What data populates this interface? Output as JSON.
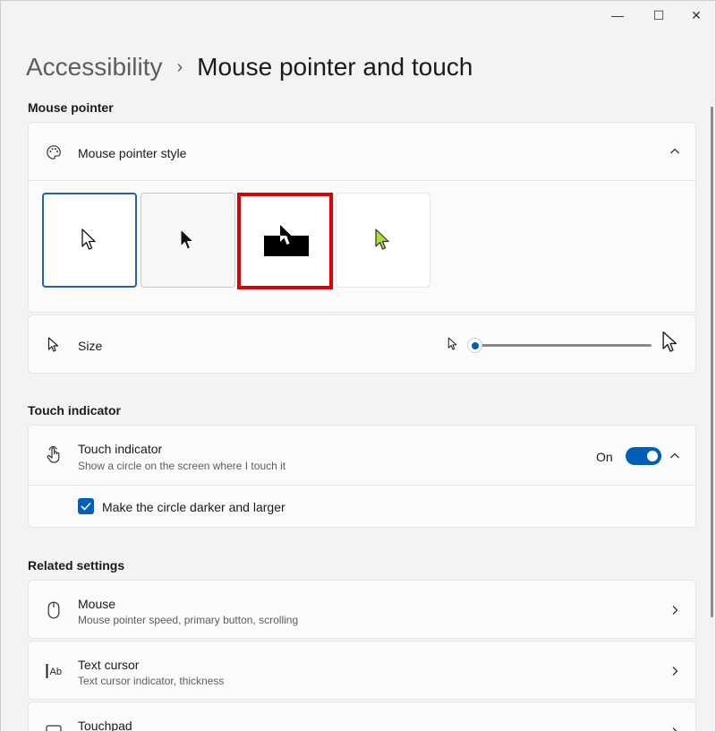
{
  "window": {
    "controls": {
      "minimize": "—",
      "maximize": "☐",
      "close": "✕"
    }
  },
  "breadcrumb": {
    "parent": "Accessibility",
    "separator": "›",
    "current": "Mouse pointer and touch"
  },
  "mouse_pointer": {
    "section_title": "Mouse pointer",
    "style_row": {
      "icon": "palette-icon",
      "title": "Mouse pointer style",
      "expanded": true,
      "options": [
        {
          "name": "white",
          "selected": true
        },
        {
          "name": "black",
          "selected": false
        },
        {
          "name": "inverted",
          "selected": false,
          "highlighted": true
        },
        {
          "name": "custom",
          "color": "#a6e22e",
          "selected": false
        }
      ]
    },
    "size_row": {
      "icon": "cursor-icon",
      "title": "Size",
      "slider_value": 0
    }
  },
  "touch_indicator": {
    "section_title": "Touch indicator",
    "row": {
      "icon": "touch-hand-icon",
      "title": "Touch indicator",
      "subtitle": "Show a circle on the screen where I touch it",
      "toggle_label": "On",
      "toggle_on": true
    },
    "checkbox": {
      "label": "Make the circle darker and larger",
      "checked": true
    }
  },
  "related_settings": {
    "section_title": "Related settings",
    "items": [
      {
        "icon": "mouse-icon",
        "title": "Mouse",
        "subtitle": "Mouse pointer speed, primary button, scrolling"
      },
      {
        "icon": "text-cursor-icon",
        "title": "Text cursor",
        "subtitle": "Text cursor indicator, thickness"
      },
      {
        "icon": "touchpad-icon",
        "title": "Touchpad",
        "subtitle": ""
      }
    ]
  },
  "colors": {
    "accent": "#005fb8",
    "highlight": "#e00000",
    "custom_pointer": "#a6e22e"
  }
}
